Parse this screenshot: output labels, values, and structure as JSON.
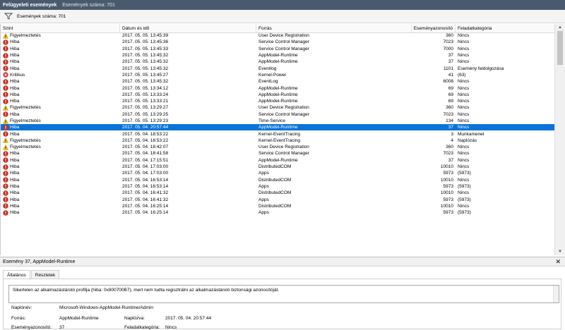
{
  "titlebar": {
    "title": "Felügyeleti események",
    "count": "Események száma: 701"
  },
  "filterbar": {
    "count": "Események száma: 701"
  },
  "columns": {
    "level": "Szint",
    "date": "Dátum és idő",
    "source": "Forrás",
    "event_id": "Eseményazonosító",
    "category": "Feladatkategória"
  },
  "colors": {
    "selected": "#0a73d9",
    "error": "#c42b1c",
    "warning": "#f2c200",
    "critical": "#d13438"
  },
  "events": [
    {
      "level": "Figyelmeztetés",
      "type": "warning",
      "date": "2017. 05. 05. 13:45:39",
      "source": "User Device Registration",
      "id": "360",
      "category": "Nincs"
    },
    {
      "level": "Hiba",
      "type": "error",
      "date": "2017. 05. 05. 13:45:36",
      "source": "Service Control Manager",
      "id": "7023",
      "category": "Nincs"
    },
    {
      "level": "Hiba",
      "type": "error",
      "date": "2017. 05. 05. 13:45:33",
      "source": "Service Control Manager",
      "id": "7000",
      "category": "Nincs"
    },
    {
      "level": "Hiba",
      "type": "error",
      "date": "2017. 05. 05. 13:45:32",
      "source": "AppModel-Runtime",
      "id": "37",
      "category": "Nincs"
    },
    {
      "level": "Hiba",
      "type": "error",
      "date": "2017. 05. 05. 13:45:32",
      "source": "AppModel-Runtime",
      "id": "37",
      "category": "Nincs"
    },
    {
      "level": "Hiba",
      "type": "error",
      "date": "2017. 05. 05. 13:45:32",
      "source": "Eventlog",
      "id": "1101",
      "category": "Esemény feldolgozása"
    },
    {
      "level": "Kritikus",
      "type": "critical",
      "date": "2017. 05. 05. 13:45:27",
      "source": "Kernel-Power",
      "id": "41",
      "category": "(63)"
    },
    {
      "level": "Hiba",
      "type": "error",
      "date": "2017. 05. 05. 13:45:32",
      "source": "EventLog",
      "id": "6008",
      "category": "Nincs"
    },
    {
      "level": "Hiba",
      "type": "error",
      "date": "2017. 05. 05. 13:34:12",
      "source": "AppModel-Runtime",
      "id": "69",
      "category": "Nincs"
    },
    {
      "level": "Hiba",
      "type": "error",
      "date": "2017. 05. 05. 13:33:24",
      "source": "AppModel-Runtime",
      "id": "69",
      "category": "Nincs"
    },
    {
      "level": "Hiba",
      "type": "error",
      "date": "2017. 05. 05. 13:33:21",
      "source": "AppModel-Runtime",
      "id": "69",
      "category": "Nincs"
    },
    {
      "level": "Figyelmeztetés",
      "type": "warning",
      "date": "2017. 05. 05. 13:29:27",
      "source": "User Device Registration",
      "id": "360",
      "category": "Nincs"
    },
    {
      "level": "Hiba",
      "type": "error",
      "date": "2017. 05. 05. 13:29:25",
      "source": "Service Control Manager",
      "id": "7023",
      "category": "Nincs"
    },
    {
      "level": "Figyelmeztetés",
      "type": "warning",
      "date": "2017. 05. 05. 13:29:23",
      "source": "Time-Service",
      "id": "134",
      "category": "Nincs"
    },
    {
      "level": "Hiba",
      "type": "error",
      "date": "2017. 05. 04. 20:57:44",
      "source": "AppModel-Runtime",
      "id": "37",
      "category": "Nincs",
      "selected": true
    },
    {
      "level": "Hiba",
      "type": "error",
      "date": "2017. 05. 04. 18:53:22",
      "source": "Kernel-EventTracing",
      "id": "3",
      "category": "Munkamenet"
    },
    {
      "level": "Figyelmeztetés",
      "type": "warning",
      "date": "2017. 05. 04. 18:53:22",
      "source": "Kernel-EventTracing",
      "id": "4",
      "category": "Naplózás"
    },
    {
      "level": "Figyelmeztetés",
      "type": "warning",
      "date": "2017. 05. 04. 18:42:07",
      "source": "User Device Registration",
      "id": "360",
      "category": "Nincs"
    },
    {
      "level": "Hiba",
      "type": "error",
      "date": "2017. 05. 04. 18:41:58",
      "source": "Service Control Manager",
      "id": "7023",
      "category": "Nincs"
    },
    {
      "level": "Hiba",
      "type": "error",
      "date": "2017. 05. 04. 17:15:51",
      "source": "AppModel-Runtime",
      "id": "37",
      "category": "Nincs"
    },
    {
      "level": "Hiba",
      "type": "error",
      "date": "2017. 05. 04. 17:03:00",
      "source": "DistributedCOM",
      "id": "10010",
      "category": "Nincs"
    },
    {
      "level": "Hiba",
      "type": "error",
      "date": "2017. 05. 04. 17:03:00",
      "source": "Apps",
      "id": "5973",
      "category": "(5973)"
    },
    {
      "level": "Hiba",
      "type": "error",
      "date": "2017. 05. 04. 16:53:14",
      "source": "DistributedCOM",
      "id": "10010",
      "category": "Nincs"
    },
    {
      "level": "Hiba",
      "type": "error",
      "date": "2017. 05. 04. 16:53:14",
      "source": "Apps",
      "id": "5973",
      "category": "(5973)"
    },
    {
      "level": "Hiba",
      "type": "error",
      "date": "2017. 05. 04. 16:41:32",
      "source": "DistributedCOM",
      "id": "10010",
      "category": "Nincs"
    },
    {
      "level": "Hiba",
      "type": "error",
      "date": "2017. 05. 04. 16:41:32",
      "source": "Apps",
      "id": "5973",
      "category": "(5973)"
    },
    {
      "level": "Hiba",
      "type": "error",
      "date": "2017. 05. 04. 16:25:14",
      "source": "DistributedCOM",
      "id": "10010",
      "category": "Nincs"
    },
    {
      "level": "Hiba",
      "type": "error",
      "date": "2017. 05. 04. 16:25:14",
      "source": "Apps",
      "id": "5973",
      "category": "(5973)"
    }
  ],
  "detail": {
    "title": "Esemény 37, AppModel-Runtime",
    "tabs": [
      "Általános",
      "Részletek"
    ],
    "message": "Sikertelen az alkalmazástároló profilja (hiba: 0x800700B7), mert nem tudta regisztrálni az alkalmazástároló biztonsági azonosítóját.",
    "log_name_label": "Naplónév:",
    "log_name_value": "Microsoft-Windows-AppModel-Runtime/Admin",
    "source_label": "Forrás:",
    "source_value": "AppModel-Runtime",
    "logged_label": "Naplózva:",
    "logged_value": "2017. 05. 04. 20:57:44",
    "event_id_label": "Eseményazonosító:",
    "event_id_value": "37",
    "task_label": "Feladatkategória:",
    "task_value": "Nincs"
  }
}
